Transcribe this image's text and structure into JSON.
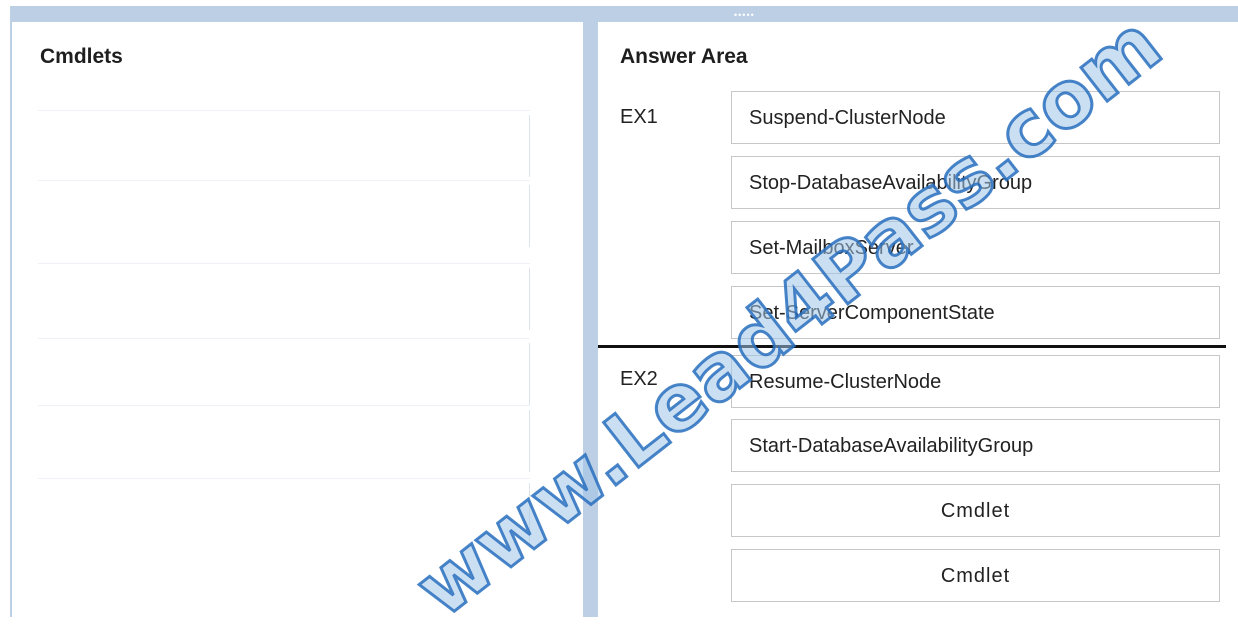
{
  "left_panel": {
    "title": "Cmdlets",
    "slots": [
      "",
      "",
      "",
      "",
      "",
      ""
    ]
  },
  "answer_area": {
    "title": "Answer Area",
    "groups": [
      {
        "label": "EX1",
        "items": [
          "Suspend-ClusterNode",
          "Stop-DatabaseAvailabilityGroup",
          "Set-MailboxServer",
          "Set-ServerComponentState"
        ]
      },
      {
        "label": "EX2",
        "items": [
          "Resume-ClusterNode",
          "Start-DatabaseAvailabilityGroup",
          "Cmdlet",
          "Cmdlet"
        ]
      }
    ]
  },
  "watermark": "www.Lead4Pass.com",
  "colors": {
    "frame": "#bccfe4",
    "box_border": "#c7c7c7",
    "watermark": "#3a7ec4"
  }
}
